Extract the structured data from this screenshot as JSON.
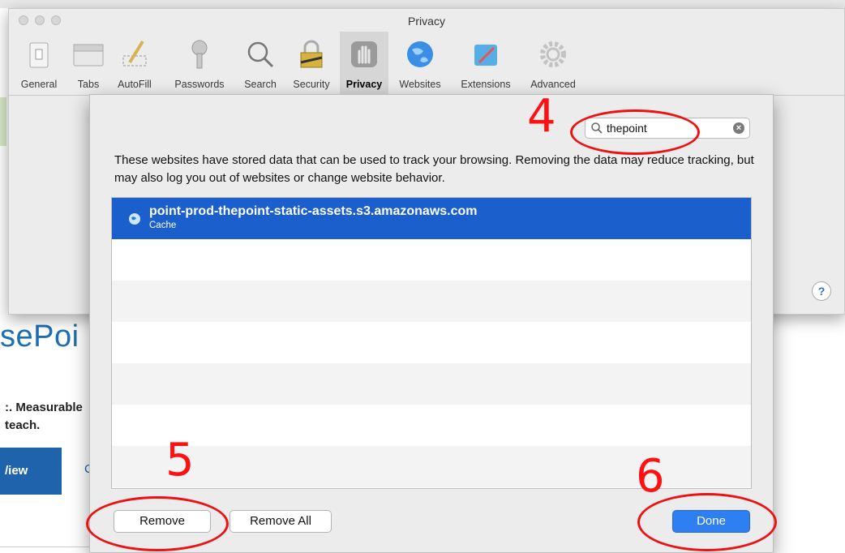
{
  "window": {
    "title": "Privacy"
  },
  "toolbar": {
    "items": [
      {
        "label": "General",
        "icon": "general-icon"
      },
      {
        "label": "Tabs",
        "icon": "tabs-icon"
      },
      {
        "label": "AutoFill",
        "icon": "autofill-icon"
      },
      {
        "label": "Passwords",
        "icon": "key-icon"
      },
      {
        "label": "Search",
        "icon": "magnifier-icon"
      },
      {
        "label": "Security",
        "icon": "lock-icon"
      },
      {
        "label": "Privacy",
        "icon": "hand-icon",
        "active": true
      },
      {
        "label": "Websites",
        "icon": "globe-icon"
      },
      {
        "label": "Extensions",
        "icon": "puzzle-icon"
      },
      {
        "label": "Advanced",
        "icon": "gear-icon"
      }
    ]
  },
  "help": {
    "label": "?"
  },
  "sheet": {
    "search": {
      "value": "thepoint",
      "icon": "search-icon",
      "clear_icon": "clear-icon"
    },
    "description": "These websites have stored data that can be used to track your browsing. Removing the data may reduce tracking, but may also log you out of websites or change website behavior.",
    "list": [
      {
        "site": "point-prod-thepoint-static-assets.s3.amazonaws.com",
        "detail": "Cache",
        "selected": true
      }
    ],
    "buttons": {
      "remove": "Remove",
      "remove_all": "Remove All",
      "done": "Done"
    }
  },
  "annotations": {
    "step4": "4",
    "step5": "5",
    "step6": "6"
  },
  "background_page": {
    "logo_fragment": "sePoi",
    "tagline": ":. Measurable\nteach.",
    "button_label": "/iew",
    "c_fragment": "C"
  },
  "colors": {
    "selection": "#1a5fcc",
    "done_button": "#2e7ff2",
    "annotation_red": "#ff1111"
  }
}
